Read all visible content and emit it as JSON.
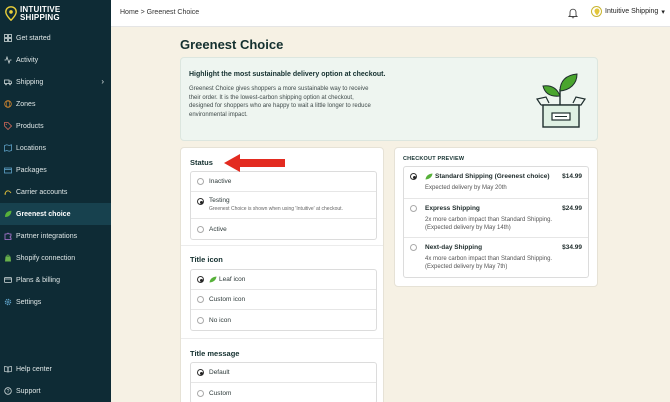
{
  "brand": {
    "name_line1": "INTUITIVE",
    "name_line2": "SHIPPING"
  },
  "sidebar": {
    "items": [
      {
        "label": "Get started",
        "icon": "grid-icon"
      },
      {
        "label": "Activity",
        "icon": "activity-icon"
      },
      {
        "label": "Shipping",
        "icon": "truck-icon",
        "has_chevron": true
      },
      {
        "label": "Zones",
        "icon": "globe-icon"
      },
      {
        "label": "Products",
        "icon": "tag-icon"
      },
      {
        "label": "Locations",
        "icon": "map-icon"
      },
      {
        "label": "Packages",
        "icon": "package-icon"
      },
      {
        "label": "Carrier accounts",
        "icon": "carrier-icon"
      },
      {
        "label": "Greenest choice",
        "icon": "leaf-icon",
        "active": true
      },
      {
        "label": "Partner integrations",
        "icon": "puzzle-icon"
      },
      {
        "label": "Shopify connection",
        "icon": "shopify-icon"
      },
      {
        "label": "Plans & billing",
        "icon": "card-icon"
      },
      {
        "label": "Settings",
        "icon": "gear-icon"
      }
    ],
    "bottom": [
      {
        "label": "Help center",
        "icon": "book-icon"
      },
      {
        "label": "Support",
        "icon": "question-icon"
      }
    ]
  },
  "header": {
    "breadcrumb": "Home > Greenest Choice",
    "account_name": "Intuitive Shipping",
    "account_caret": "▾"
  },
  "main": {
    "title": "Greenest Choice",
    "banner": {
      "title": "Highlight the most sustainable delivery option at checkout.",
      "text": "Greenest Choice gives shoppers a more sustainable way to receive their order. It is the lowest-carbon shipping option at checkout, designed for shoppers who are happy to wait a little longer to reduce environmental impact."
    },
    "status": {
      "title": "Status",
      "options": [
        {
          "label": "Inactive",
          "selected": false
        },
        {
          "label": "Testing",
          "selected": true,
          "sub": "Greenest Choice is shown when using 'Intuitive' at checkout."
        },
        {
          "label": "Active",
          "selected": false
        }
      ]
    },
    "title_icon": {
      "title": "Title icon",
      "options": [
        {
          "label": "Leaf icon",
          "selected": true
        },
        {
          "label": "Custom icon",
          "selected": false
        },
        {
          "label": "No icon",
          "selected": false
        }
      ]
    },
    "title_message": {
      "title": "Title message",
      "options": [
        {
          "label": "Default",
          "selected": true
        },
        {
          "label": "Custom",
          "selected": false
        }
      ]
    },
    "preview": {
      "title": "CHECKOUT PREVIEW",
      "items": [
        {
          "name": "Standard Shipping (Greenest choice)",
          "price": "$14.99",
          "desc1": "Expected delivery by May 20th",
          "desc2": "",
          "selected": true
        },
        {
          "name": "Express Shipping",
          "price": "$24.99",
          "desc1": "2x more carbon impact than Standard Shipping.",
          "desc2": "(Expected delivery by May 14th)",
          "selected": false
        },
        {
          "name": "Next-day Shipping",
          "price": "$34.99",
          "desc1": "4x more carbon impact than Standard Shipping.",
          "desc2": "(Expected delivery by May 7th)",
          "selected": false
        }
      ]
    }
  },
  "colors": {
    "sidebar_bg": "#0e2b35",
    "active_bg": "#17414e",
    "page_bg": "#f6f1e4",
    "accent_green": "#4a9a2c",
    "arrow_red": "#e32b20"
  }
}
